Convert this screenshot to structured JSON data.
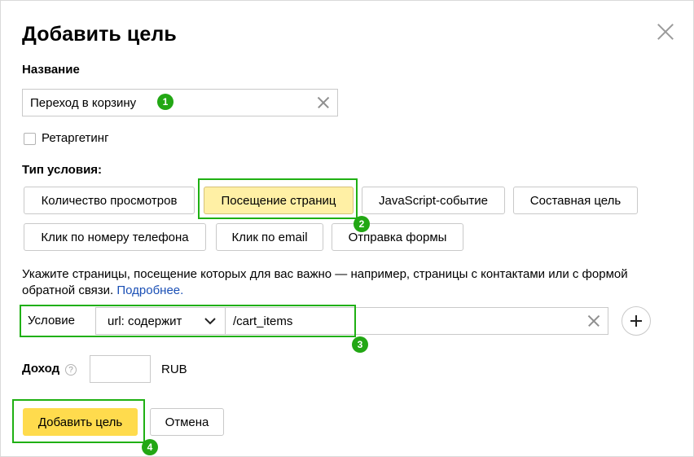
{
  "dialog": {
    "title": "Добавить цель",
    "name_section": {
      "label": "Название",
      "value": "Переход в корзину",
      "badge": "1"
    },
    "retargeting_label": "Ретаргетинг",
    "condition_type": {
      "label": "Тип условия:",
      "options": [
        "Количество просмотров",
        "Посещение страниц",
        "JavaScript-событие",
        "Составная цель",
        "Клик по номеру телефона",
        "Клик по email",
        "Отправка формы"
      ],
      "selected": "Посещение страниц",
      "badge": "2"
    },
    "hint": {
      "text": "Укажите страницы, посещение которых для вас важно — например, страницы с контактами или с формой обратной связи. ",
      "link": "Подробнее."
    },
    "condition": {
      "label": "Условие",
      "match_type": "url: содержит",
      "value": "/cart_items",
      "badge": "3"
    },
    "revenue": {
      "label": "Доход",
      "help": "?",
      "value": "",
      "currency": "RUB"
    },
    "actions": {
      "submit": "Добавить цель",
      "cancel": "Отмена",
      "badge": "4"
    }
  },
  "colors": {
    "highlight": "#1fb013",
    "badge": "#22a714",
    "primary_button": "#ffdb4d",
    "selected_option": "#fff0a5",
    "link": "#1a4fb5"
  }
}
